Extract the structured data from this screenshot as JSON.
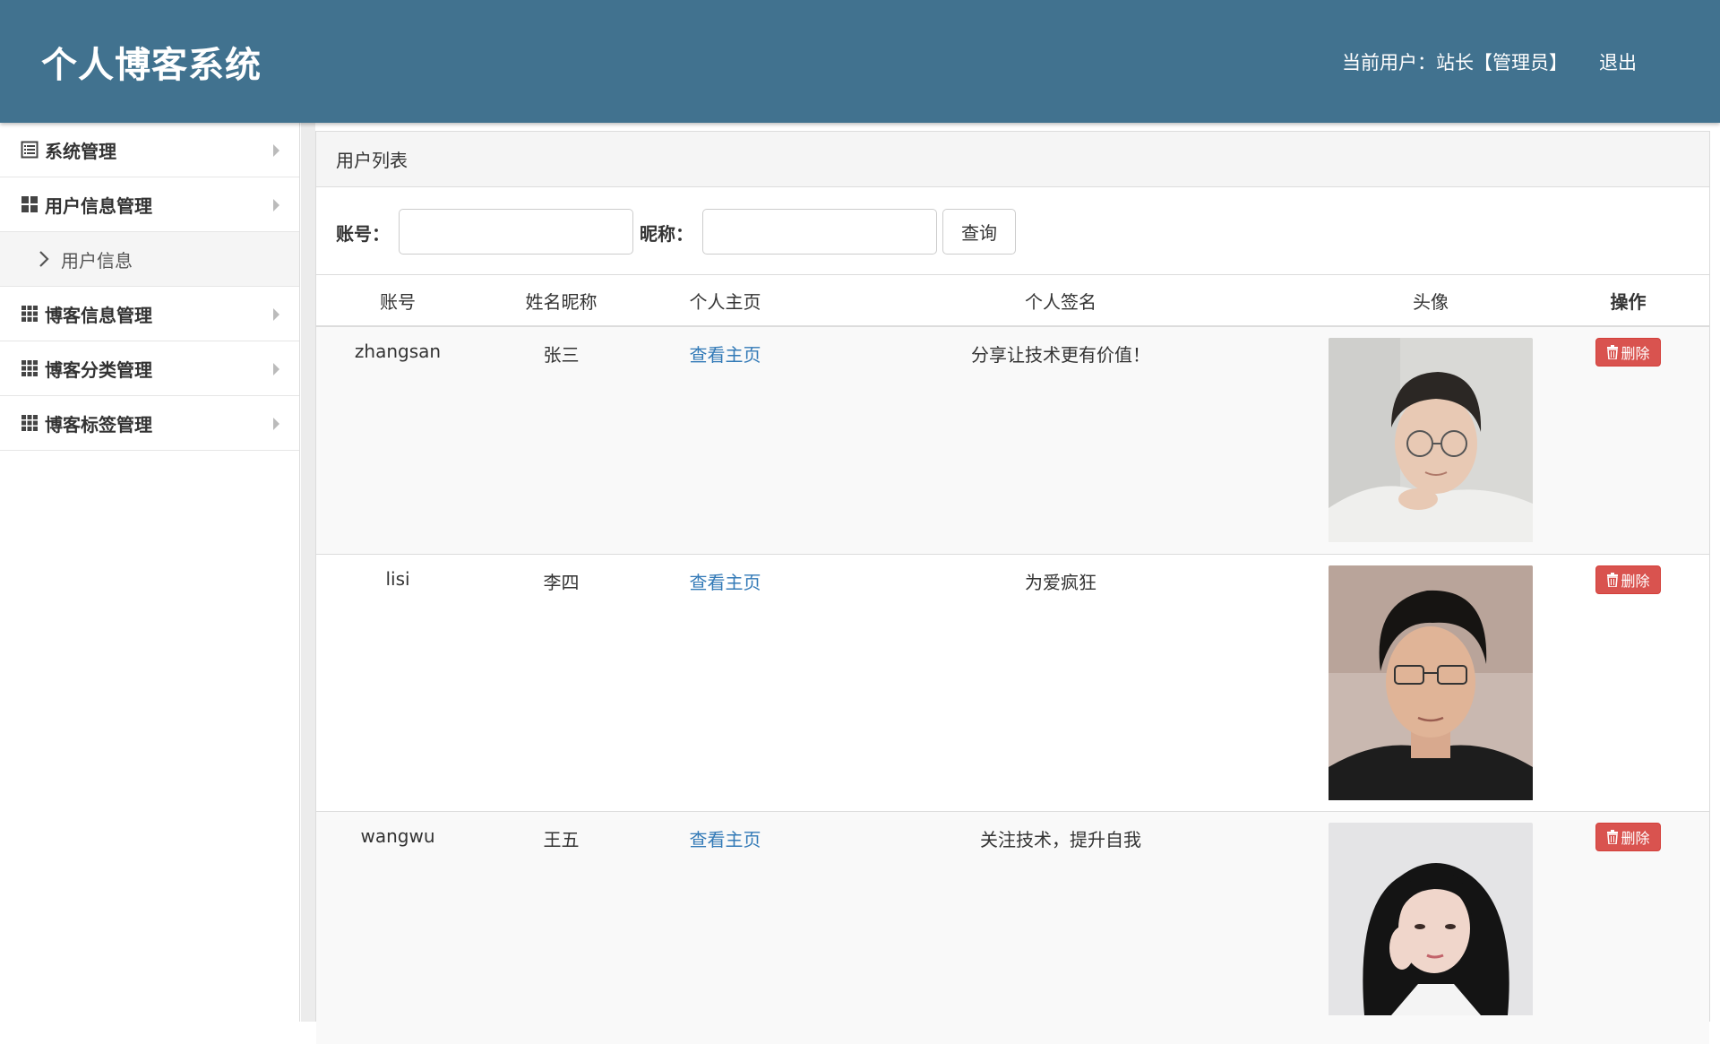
{
  "header": {
    "brand": "个人博客系统",
    "user_info": "当前用户：站长【管理员】",
    "logout": "退出"
  },
  "sidebar": {
    "items": [
      {
        "label": "系统管理",
        "icon": "list-alt-icon"
      },
      {
        "label": "用户信息管理",
        "icon": "th-large-icon"
      },
      {
        "label": "博客信息管理",
        "icon": "th-icon"
      },
      {
        "label": "博客分类管理",
        "icon": "th-icon"
      },
      {
        "label": "博客标签管理",
        "icon": "th-icon"
      }
    ],
    "sub_item": {
      "label": "用户信息",
      "icon": "chevron-right-icon"
    }
  },
  "panel": {
    "title": "用户列表",
    "search": {
      "account_label": "账号：",
      "account_value": "",
      "nickname_label": "昵称：",
      "nickname_value": "",
      "button": "查询"
    },
    "columns": [
      "账号",
      "姓名昵称",
      "个人主页",
      "个人签名",
      "头像",
      "操作"
    ],
    "rows": [
      {
        "account": "zhangsan",
        "name": "张三",
        "homepage": "查看主页",
        "signature": "分享让技术更有价值！",
        "avatar": "young man with round glasses, light background",
        "action": "删除"
      },
      {
        "account": "lisi",
        "name": "李四",
        "homepage": "查看主页",
        "signature": "为爱疯狂",
        "avatar": "young man with glasses, dark shirt",
        "action": "删除"
      },
      {
        "account": "wangwu",
        "name": "王五",
        "homepage": "查看主页",
        "signature": "关注技术，提升自我",
        "avatar": "young woman with long black hair",
        "action": "删除"
      }
    ]
  },
  "colors": {
    "header_bg": "#41728f",
    "link": "#337ab7",
    "danger": "#d9534f"
  }
}
